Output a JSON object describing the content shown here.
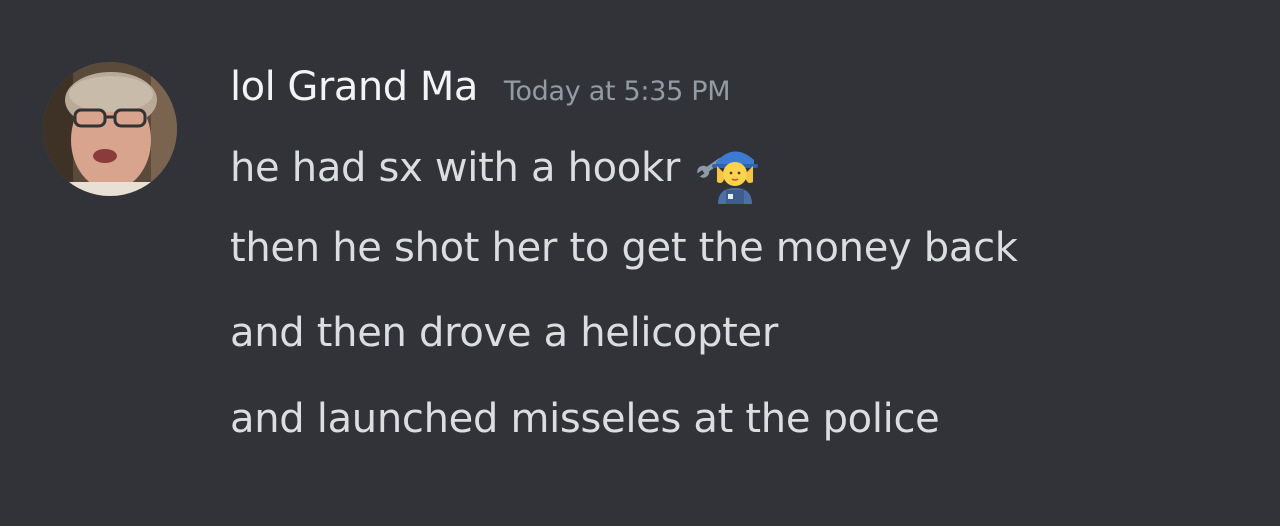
{
  "message": {
    "author": "lol Grand Ma",
    "timestamp": "Today at 5:35 PM",
    "avatar_icon": "user-avatar-photo",
    "lines": [
      "he had sx with a hookr",
      "then he shot her to get the money back",
      "and then drove a helicopter",
      "and launched misseles at the police"
    ],
    "emoji_icon": "woman-mechanic-emoji"
  },
  "colors": {
    "background": "#313338",
    "username": "#f2f3f5",
    "timestamp": "#949ba4",
    "message_text": "#dbdee1"
  }
}
